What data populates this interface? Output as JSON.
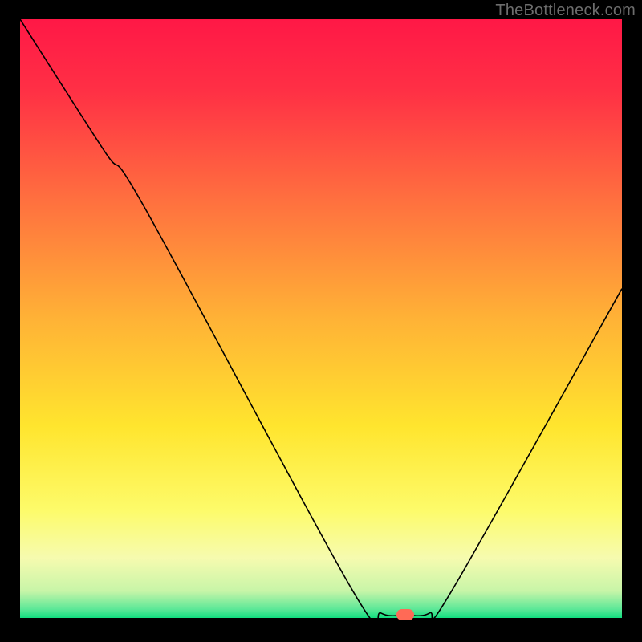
{
  "watermark": "TheBottleneck.com",
  "chart_data": {
    "type": "line",
    "title": "",
    "xlabel": "",
    "ylabel": "",
    "xlim": [
      0,
      100
    ],
    "ylim": [
      0,
      100
    ],
    "series": [
      {
        "name": "bottleneck-curve",
        "x": [
          0,
          14,
          21,
          55,
          60,
          64,
          68,
          72,
          100
        ],
        "values": [
          100,
          78,
          68,
          5,
          0.8,
          0.5,
          0.8,
          5,
          55
        ]
      }
    ],
    "marker": {
      "name": "sweet-spot",
      "x": 64,
      "y": 0.5,
      "color": "#ff6a56"
    },
    "background_gradient": {
      "stops": [
        {
          "pos": 0.0,
          "color": "#ff1846"
        },
        {
          "pos": 0.12,
          "color": "#ff3045"
        },
        {
          "pos": 0.3,
          "color": "#ff6f3f"
        },
        {
          "pos": 0.5,
          "color": "#ffb236"
        },
        {
          "pos": 0.68,
          "color": "#ffe52e"
        },
        {
          "pos": 0.82,
          "color": "#fdfb6a"
        },
        {
          "pos": 0.9,
          "color": "#f6fbaf"
        },
        {
          "pos": 0.955,
          "color": "#c8f5a8"
        },
        {
          "pos": 0.985,
          "color": "#5ee898"
        },
        {
          "pos": 1.0,
          "color": "#11de7f"
        }
      ]
    }
  }
}
